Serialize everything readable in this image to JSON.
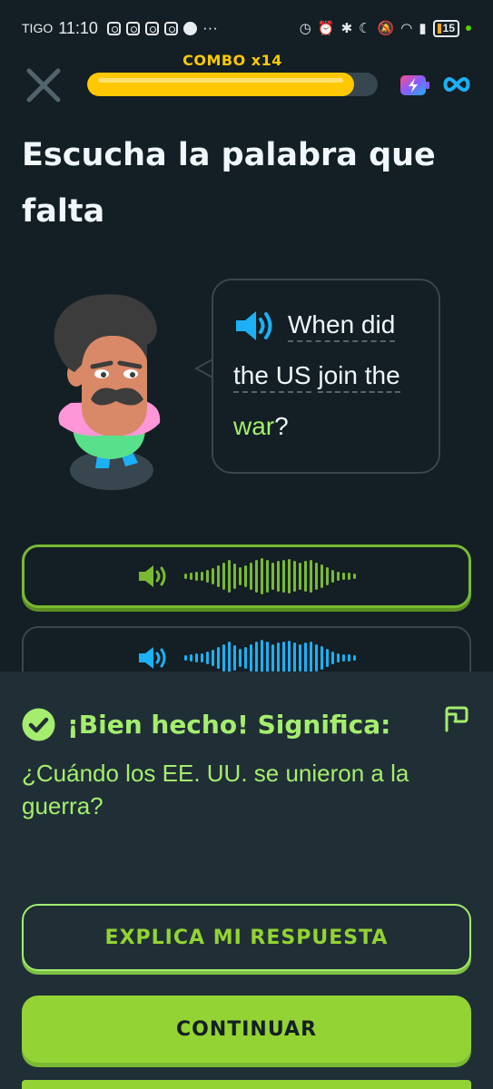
{
  "status_bar": {
    "carrier": "TIGO",
    "time": "11:10",
    "more": "···",
    "battery": "15"
  },
  "header": {
    "combo_label": "COMBO x14",
    "progress": 0.92,
    "close_icon": "close-icon",
    "energy_icon": "energy-icon",
    "infinity_icon": "infinity-icon"
  },
  "prompt": {
    "title": "Escucha la palabra que falta"
  },
  "bubble": {
    "line1": "When did",
    "line2_a": "the US",
    "line2_b": "join the",
    "line3_missing": "war",
    "line3_punct": "?"
  },
  "options": [
    {
      "id": "slow-audio",
      "selected": true
    },
    {
      "id": "normal-audio",
      "selected": false
    }
  ],
  "feedback": {
    "title": "¡Bien hecho! Significa:",
    "translation": "¿Cuándo los EE. UU. se unieron a la guerra?",
    "explain_button": "EXPLICA MI RESPUESTA",
    "continue_button": "CONTINUAR"
  },
  "colors": {
    "background": "#131f24",
    "panel": "#202f36",
    "accent_green": "#93d333",
    "light_green": "#a5ed6e",
    "combo_yellow": "#ffc800",
    "speaker_blue": "#1cb0f6"
  }
}
